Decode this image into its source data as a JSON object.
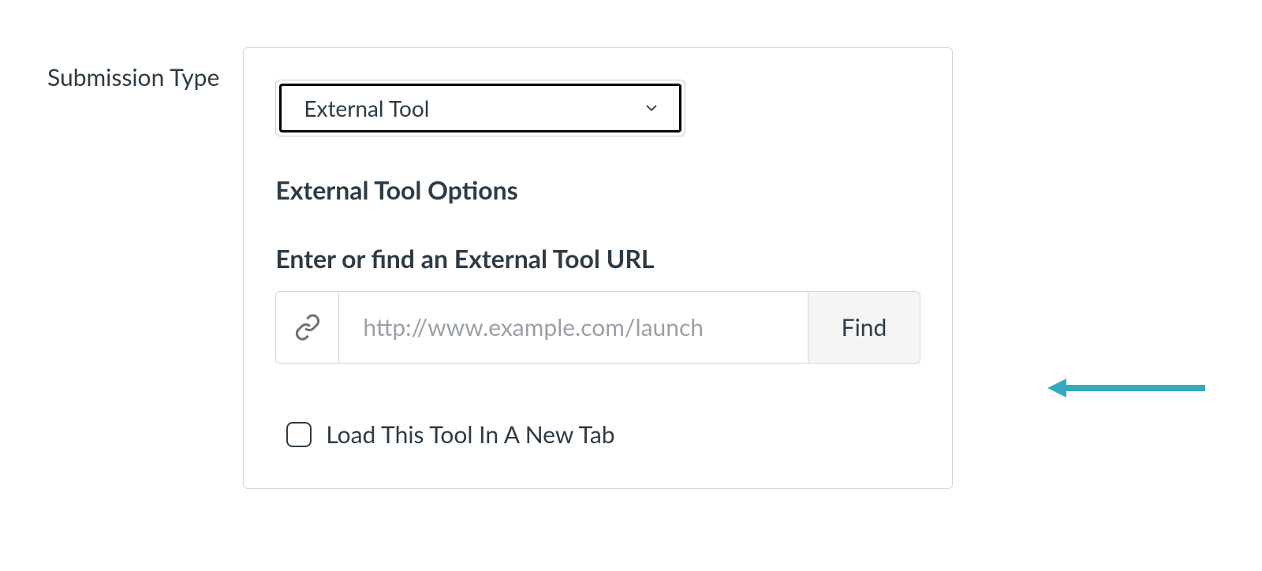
{
  "field_label": "Submission Type",
  "submission_type_select": {
    "value": "External Tool"
  },
  "section_heading": "External Tool Options",
  "url_section": {
    "heading": "Enter or find an External Tool URL",
    "placeholder": "http://www.example.com/launch",
    "value": "",
    "find_button_label": "Find"
  },
  "load_new_tab": {
    "label": "Load This Tool In A New Tab",
    "checked": false
  },
  "colors": {
    "accent_arrow": "#36a9bf"
  }
}
